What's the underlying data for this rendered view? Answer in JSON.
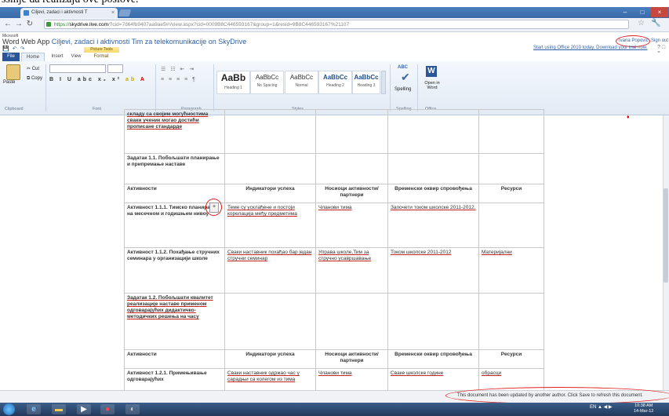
{
  "caption": "ssinje da realizaju ove poslove.",
  "browser": {
    "tab_title": "Ciljevi, zadaci i aktivnosti T",
    "tab_close": "×",
    "url_scheme": "https://",
    "url_host": "skydrive.live.com",
    "url_rest": "/?cid=7d64fb9407aa9ae5#!/view.aspx?cid=0009B8C446593167&group=1&resid=9B8C446593167%21107",
    "win_min": "–",
    "win_max": "□",
    "win_close": "×"
  },
  "office": {
    "ms_logo": "Microsoft",
    "app_name": "Word Web App",
    "doc_title": "Ciljevi, zadaci i aktivnosti Tim za telekomunikacije on SkyDrive",
    "user": "Ivana Popovic",
    "sign_out": "Sign out",
    "upgrade_link": "Start using Office 2010 today. Download your trial now.",
    "picture_tools": "Picture Tools",
    "tabs": [
      "File",
      "Home",
      "Insert",
      "View",
      "Format"
    ]
  },
  "ribbon": {
    "paste": "Paste",
    "cut": "Cut",
    "copy": "Copy",
    "styles": [
      {
        "sample": "AaBb",
        "name": "Heading 1"
      },
      {
        "sample": "AaBbCc",
        "name": "No Spacing"
      },
      {
        "sample": "AaBbCc",
        "name": "Normal"
      },
      {
        "sample": "AaBbCc",
        "name": "Heading 2"
      },
      {
        "sample": "AaBbCc",
        "name": "Heading 3"
      }
    ],
    "spelling_abc": "ABC",
    "spelling": "Spelling",
    "open_in_word": "Open in Word",
    "groups": [
      "Clipboard",
      "Font",
      "Paragraph",
      "Styles",
      "Spelling",
      "Office"
    ]
  },
  "document": {
    "rows": [
      [
        "складу са својим могућностима сваки ученик могао достићи прописане стандарде",
        "",
        "",
        "",
        ""
      ],
      [
        "Задатак 1.1. Побољшати планирање и припремање наставе",
        "",
        "",
        "",
        ""
      ],
      [
        "Активности",
        "Индикатори успеха",
        "Носиоци активности/ партнери",
        "Временски оквир спровођења",
        "Ресурси"
      ],
      [
        "Активност 1.1.1. Тимско планирање на месечном и годишњем нивоу",
        "Теме су усклађене и постоји корелација међу предметима",
        "Чланови тима",
        "Започети током школске 2011-2012.",
        ""
      ],
      [
        "Активност 1.1.2. Похађање стручних семинара у организацији школе",
        "Сваки наставник похађао бар један стручни семинар",
        "Управа школе,Тим за стручно усавршавање",
        "Током школске 2011-2012",
        "Материјални"
      ],
      [
        "Задатак 1.2. Побољшати квалитет реализације наставе применом одговарајућих дидактичко-методичких решења на часу",
        "",
        "",
        "",
        ""
      ],
      [
        "Активности",
        "Индикатори успеха",
        "Носиоци активности/ партнери",
        "Временски оквир спровођења",
        "Ресурси"
      ],
      [
        "Активност 1.2.1. Примењивање одговарајућих",
        "Сваки наставник одржао час у сарадњи са колегом из тима",
        "Чланови тима",
        "Сваке школске године",
        "обрасци"
      ]
    ],
    "handle_icon": "+"
  },
  "notification": "This document has been updated by another author. Click Save to refresh this document.",
  "taskbar": {
    "tray": "EN ▲ ◀ ▶",
    "time": "10:38 AM",
    "date": "14-Mar-12"
  }
}
